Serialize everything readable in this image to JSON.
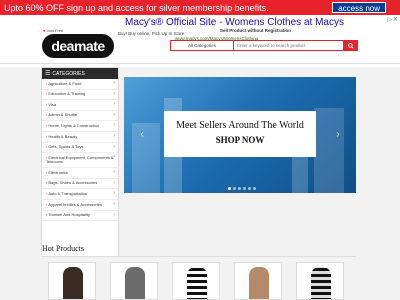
{
  "topbar": {
    "promo": "Upto 60% OFF sign up and access for silver membership benefits.",
    "access_button": "access now"
  },
  "ad": {
    "title": "Macy's® Official Site - Womens Clothes at Macys",
    "subtitle": "Buy! Buy online, Pick Up In Store",
    "url": "www.macys.com/Macys/WomensClothing",
    "corner": "▷",
    "close": "✕"
  },
  "header": {
    "join_text": "Join Free",
    "logo_text": "deamate",
    "seller_text": "Sell Product without Registration",
    "search": {
      "category": "All Categories",
      "placeholder": "Enter a keyword to search product"
    }
  },
  "sidebar": {
    "title": "CATEGORIES",
    "items": [
      {
        "label": "Agriculture & Food"
      },
      {
        "label": "Education & Training"
      },
      {
        "label": "Visa"
      },
      {
        "label": "Admin & Shuttle"
      },
      {
        "label": "Home, Lights & Construction"
      },
      {
        "label": "Health & Beauty"
      },
      {
        "label": "Gifts, Sports & Toys"
      },
      {
        "label": "Electrical Equipment, Components & Telecoms"
      },
      {
        "label": "Electronics"
      },
      {
        "label": "Bags, Shoes & Accessories"
      },
      {
        "label": "Auto & Transportation"
      },
      {
        "label": "Apparel,textiles & Accessories"
      },
      {
        "label": "Tourism And Hospitality"
      }
    ]
  },
  "banner": {
    "title": "Meet Sellers Around The World",
    "cta": "SHOP NOW",
    "prev": "‹",
    "next": "›"
  },
  "hot": {
    "title": "Hot Products"
  },
  "colors": {
    "accent": "#e8222b",
    "dark": "#2a2a2a"
  }
}
